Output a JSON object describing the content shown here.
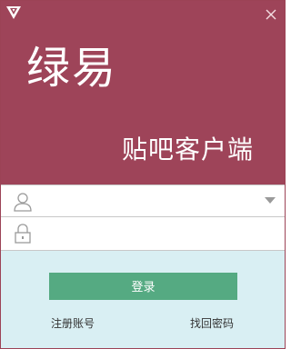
{
  "window": {
    "brand_title": "绿易",
    "brand_subtitle": "贴吧客户端",
    "close_icon": "close-icon",
    "logo_icon": "triangle-logo-icon"
  },
  "colors": {
    "banner": "#9e4459",
    "button": "#55aa82",
    "panel": "#d9eff3"
  },
  "form": {
    "username": {
      "value": "",
      "placeholder": "",
      "icon": "user-icon"
    },
    "password": {
      "value": "",
      "placeholder": "",
      "icon": "lock-icon"
    },
    "dropdown_icon": "dropdown-arrow-icon"
  },
  "actions": {
    "login_label": "登录",
    "register_label": "注册账号",
    "forgot_label": "找回密码"
  }
}
